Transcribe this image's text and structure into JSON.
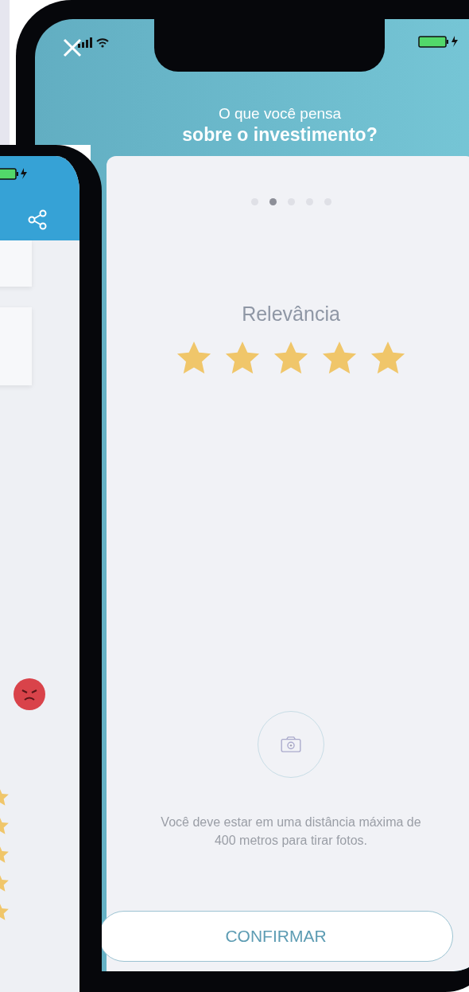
{
  "main_phone": {
    "title_line1": "O que você pensa",
    "title_line2": "sobre o investimento?",
    "pager": [
      {
        "selected": false
      },
      {
        "selected": true
      },
      {
        "selected": false
      },
      {
        "selected": false
      },
      {
        "selected": false
      }
    ],
    "rating": {
      "label": "Relevância",
      "stars": 5
    },
    "photo_note": "Você deve estar em uma distância máxima de 400 metros para tirar fotos.",
    "confirm_button": "CONFIRMAR"
  }
}
